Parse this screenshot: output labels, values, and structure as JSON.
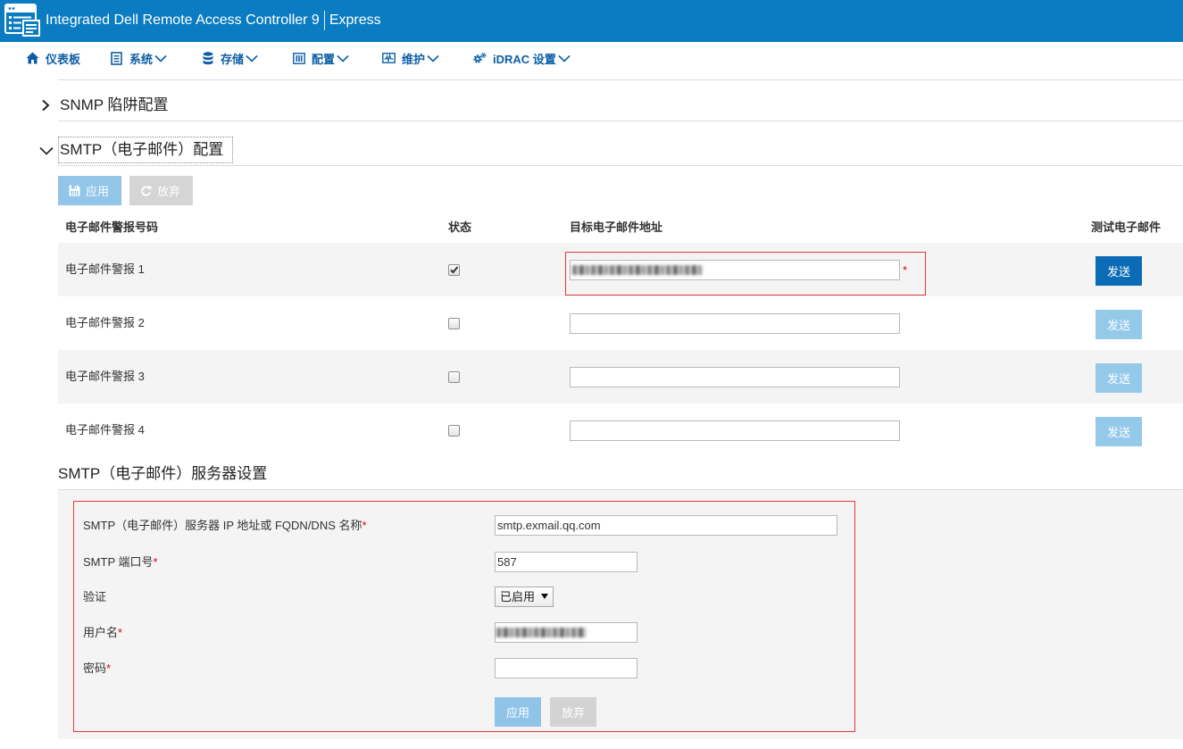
{
  "header": {
    "app_title": "Integrated Dell Remote Access Controller 9",
    "edition": "Express",
    "logo_icon": "idrac-server-icon"
  },
  "nav": [
    {
      "label": "仪表板",
      "icon": "home-icon",
      "dropdown": false
    },
    {
      "label": "系统",
      "icon": "system-icon",
      "dropdown": true
    },
    {
      "label": "存储",
      "icon": "storage-icon",
      "dropdown": true
    },
    {
      "label": "配置",
      "icon": "configuration-icon",
      "dropdown": true
    },
    {
      "label": "维护",
      "icon": "maintenance-icon",
      "dropdown": true
    },
    {
      "label": "iDRAC 设置",
      "icon": "idrac-settings-icon",
      "dropdown": true
    }
  ],
  "required_mark": "*",
  "snmp_section": {
    "title": "SNMP 陷阱配置",
    "expanded": false,
    "toggle_icon": "chevron-right-icon"
  },
  "smtp_section": {
    "title": "SMTP（电子邮件）配置",
    "expanded": true,
    "toggle_icon": "chevron-down-icon",
    "apply_label": "应用",
    "apply_icon": "save-icon",
    "discard_label": "放弃",
    "discard_icon": "refresh-icon",
    "columns": {
      "alert_number": "电子邮件警报号码",
      "state": "状态",
      "destination": "目标电子邮件地址",
      "test": "测试电子邮件"
    },
    "alerts": [
      {
        "name": "电子邮件警报 1",
        "enabled": true,
        "destination_redacted": true,
        "destination_required": true,
        "send_label": "发送",
        "send_enabled": true
      },
      {
        "name": "电子邮件警报 2",
        "enabled": false,
        "destination": "",
        "send_label": "发送",
        "send_enabled": false
      },
      {
        "name": "电子邮件警报 3",
        "enabled": false,
        "destination": "",
        "send_label": "发送",
        "send_enabled": false
      },
      {
        "name": "电子邮件警报 4",
        "enabled": false,
        "destination": "",
        "send_label": "发送",
        "send_enabled": false
      }
    ]
  },
  "server_section": {
    "title": "SMTP（电子邮件）服务器设置",
    "address_label": "SMTP（电子邮件）服务器 IP 地址或 FQDN/DNS 名称",
    "address_value": "smtp.exmail.qq.com",
    "port_label": "SMTP 端口号",
    "port_value": "587",
    "auth_label": "验证",
    "auth_value": "已启用",
    "username_label": "用户名",
    "username_redacted": true,
    "password_label": "密码",
    "password_value": "",
    "apply_label": "应用",
    "discard_label": "放弃"
  },
  "colors": {
    "header_bg": "#0b7cc1",
    "nav_text": "#0c5ea6",
    "primary_button": "#0b6cb5",
    "disabled_button": "#95c9ea",
    "secondary_disabled_button": "#d5d5d5",
    "highlight_border": "#e0393e",
    "required_mark": "#d0021b",
    "panel_bg": "#f4f4f4"
  }
}
